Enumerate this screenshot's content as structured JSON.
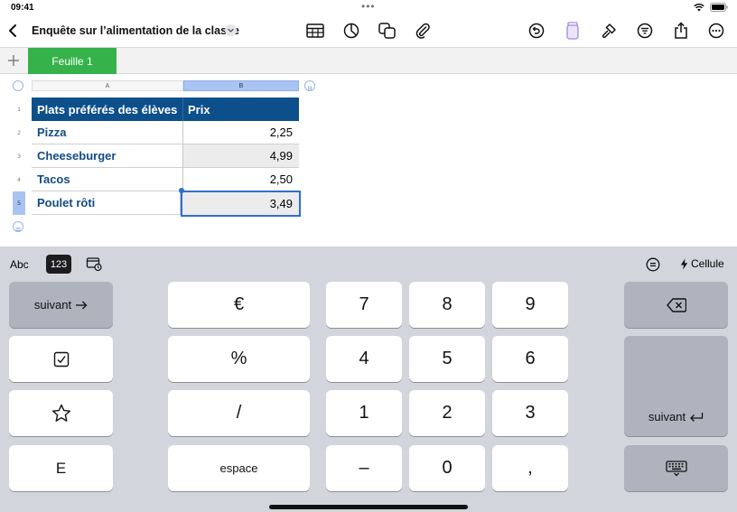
{
  "status": {
    "time": "09:41",
    "dots": "•••"
  },
  "toolbar": {
    "title": "Enquête sur l’alimentation de la classe"
  },
  "tabs": {
    "sheet1": "Feuille 1"
  },
  "columns": {
    "a": "A",
    "b": "B"
  },
  "rows": [
    "1",
    "2",
    "3",
    "4",
    "5"
  ],
  "table": {
    "headers": [
      "Plats préférés des élèves",
      "Prix"
    ],
    "items": [
      {
        "name": "Pizza",
        "price": "2,25"
      },
      {
        "name": "Cheeseburger",
        "price": "4,99"
      },
      {
        "name": "Tacos",
        "price": "2,50"
      },
      {
        "name": "Poulet rôti",
        "price": "3,49"
      }
    ]
  },
  "keyboard": {
    "abc": "Abc",
    "num": "123",
    "cell": "Cellule",
    "next": "suivant",
    "next_return": "suivant",
    "euro": "€",
    "percent": "%",
    "slash": "/",
    "space": "espace",
    "e": "E",
    "minus": "–",
    "comma": ",",
    "digits": [
      "7",
      "8",
      "9",
      "4",
      "5",
      "6",
      "1",
      "2",
      "3",
      "0"
    ]
  },
  "colors": {
    "header_blue": "#0d4f8b",
    "tab_green": "#35b34a",
    "selection_blue": "#2f6fce"
  }
}
